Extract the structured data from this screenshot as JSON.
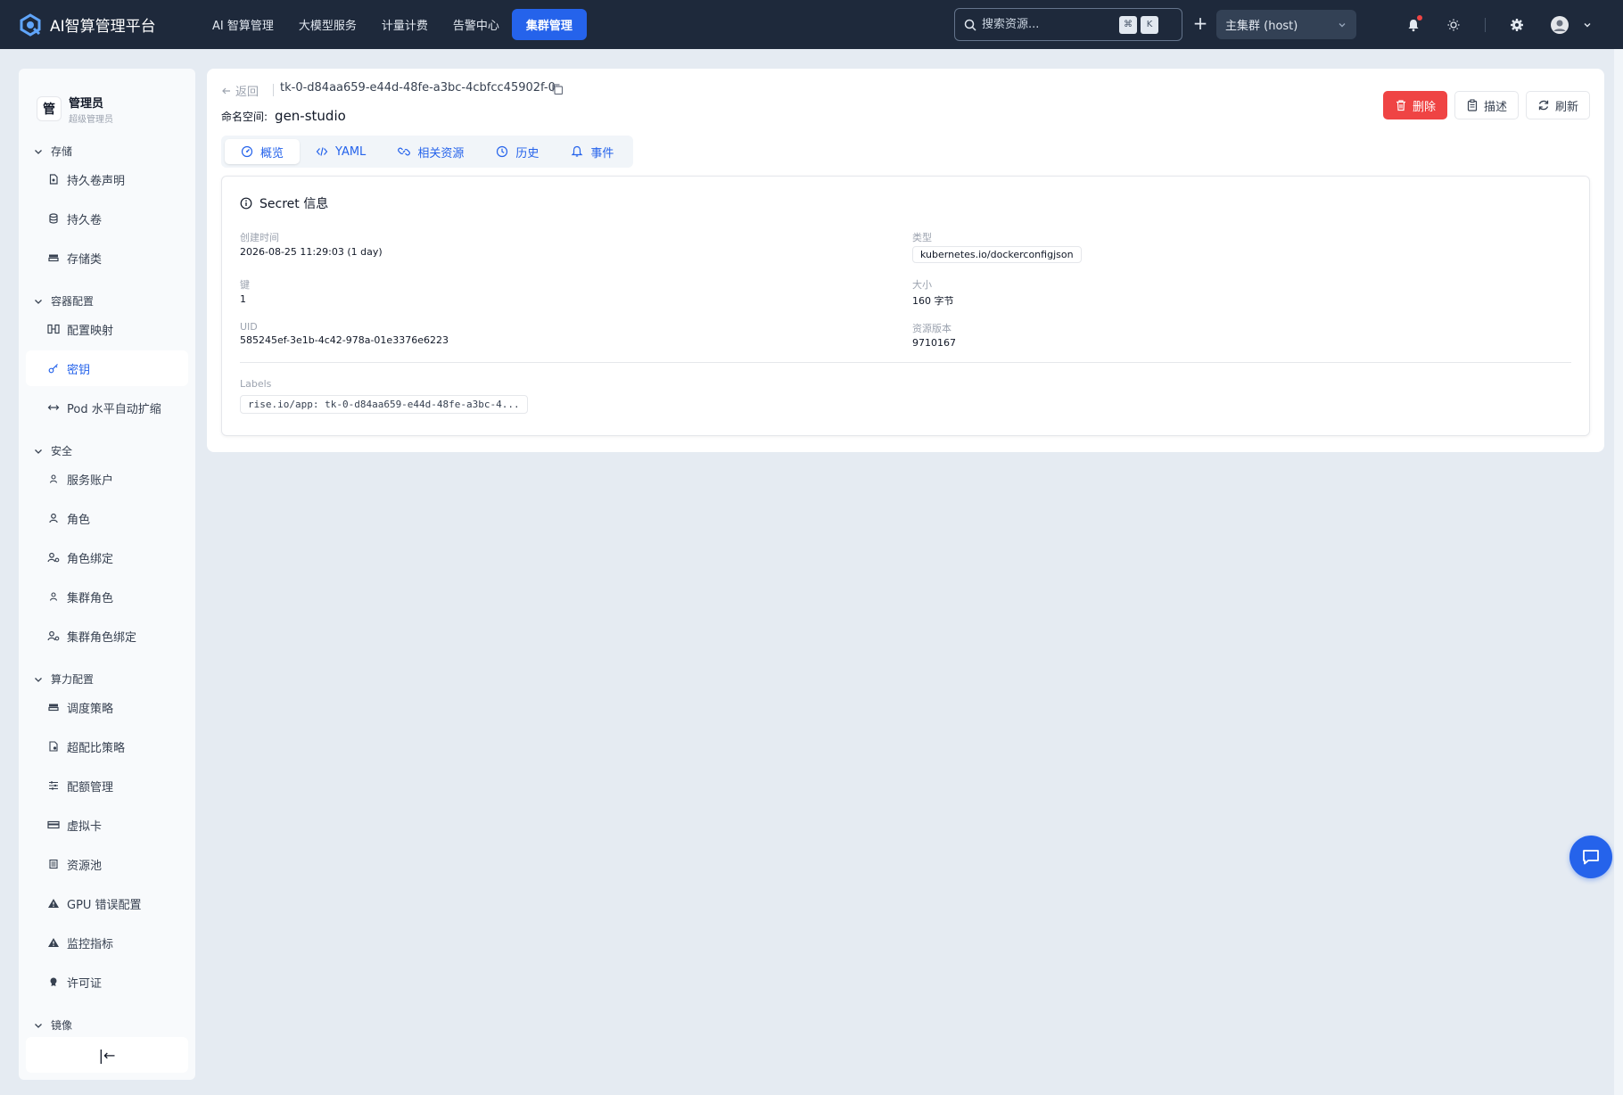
{
  "app": {
    "title": "AI智算管理平台"
  },
  "topnav": {
    "items": [
      "AI 智算管理",
      "大模型服务",
      "计量计费",
      "告警中心"
    ],
    "active": "集群管理"
  },
  "search": {
    "placeholder": "搜索资源...",
    "kbd1": "⌘",
    "kbd2": "K"
  },
  "cluster_select": {
    "value": "主集群 (host)"
  },
  "user": {
    "avatar_char": "管",
    "name": "管理员",
    "role": "超级管理员"
  },
  "sidebar": {
    "groups": {
      "storage": "存储",
      "config": "容器配置",
      "security": "安全",
      "compute": "算力配置",
      "image": "镜像"
    },
    "items": {
      "pvc": "持久卷声明",
      "pv": "持久卷",
      "storageclass": "存储类",
      "configmap": "配置映射",
      "secret": "密钥",
      "hpa": "Pod 水平自动扩缩",
      "serviceaccount": "服务账户",
      "role": "角色",
      "rolebinding": "角色绑定",
      "clusterrole": "集群角色",
      "clusterrolebinding": "集群角色绑定",
      "schedpolicy": "调度策略",
      "overcommit": "超配比策略",
      "quota": "配额管理",
      "vcard": "虚拟卡",
      "pool": "资源池",
      "gpuerror": "GPU 错误配置",
      "metrics": "监控指标",
      "license": "许可证"
    },
    "collapse_label": "|←"
  },
  "detail": {
    "back": "返回",
    "name": "tk-0-d84aa659-e44d-48fe-a3bc-4cbfcc45902f-0",
    "namespace_label": "命名空间:",
    "namespace": "gen-studio",
    "actions": {
      "delete": "删除",
      "describe": "描述",
      "refresh": "刷新"
    },
    "tabs": {
      "overview": "概览",
      "yaml": "YAML",
      "related": "相关资源",
      "history": "历史",
      "events": "事件"
    },
    "card_title": "Secret 信息",
    "fields": {
      "created_label": "创建时间",
      "created_value": "2026-08-25 11:29:03 (1 day)",
      "type_label": "类型",
      "type_value": "kubernetes.io/dockerconfigjson",
      "keys_label": "键",
      "keys_value": "1",
      "size_label": "大小",
      "size_value": "160 字节",
      "uid_label": "UID",
      "uid_value": "585245ef-3e1b-4c42-978a-01e3376e6223",
      "version_label": "资源版本",
      "version_value": "9710167"
    },
    "labels_title": "Labels",
    "labels": [
      "rise.io/app: tk-0-d84aa659-e44d-48fe-a3bc-4..."
    ]
  },
  "colors": {
    "topbar": "#1e293b",
    "accent": "#2563eb",
    "danger": "#ef4444",
    "page_bg": "#e5ebf2"
  }
}
